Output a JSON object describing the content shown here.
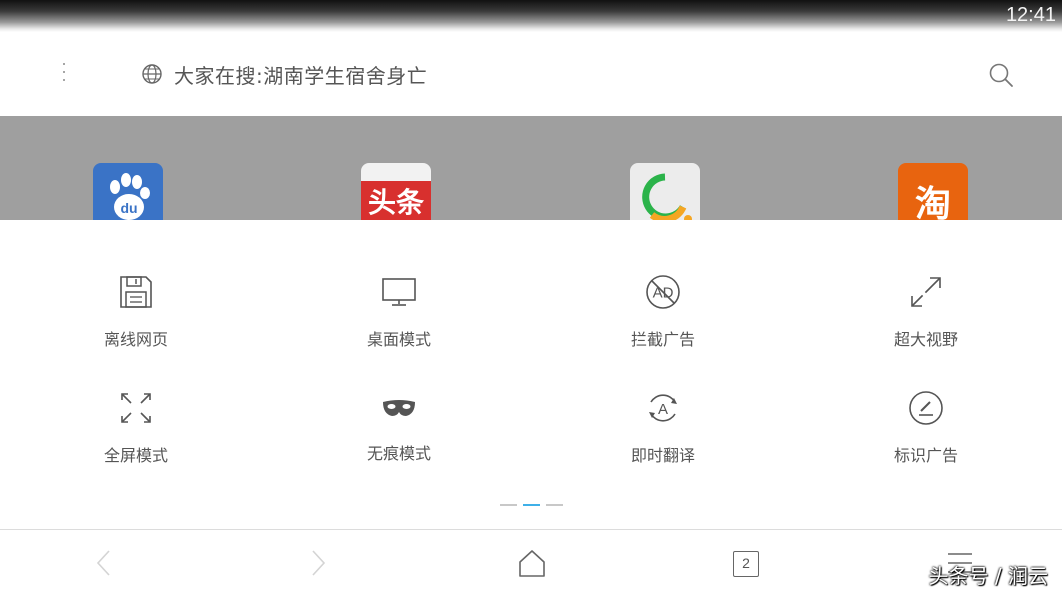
{
  "status_bar": {
    "time": "12:41"
  },
  "top_bar": {
    "search_text": "大家在搜:湖南学生宿舍身亡",
    "icons": [
      "menu-dots-icon",
      "globe-icon",
      "search-icon"
    ]
  },
  "shortcuts": [
    {
      "name": "baidu",
      "glyph": "du",
      "color": "#3a73c6"
    },
    {
      "name": "toutiao",
      "glyph": "头条",
      "color": "#d8302e"
    },
    {
      "name": "search-app",
      "glyph": "",
      "color": "#ececec"
    },
    {
      "name": "taobao",
      "glyph": "淘",
      "color": "#e8640f"
    }
  ],
  "options": [
    {
      "label": "离线网页",
      "icon": "save-icon"
    },
    {
      "label": "桌面模式",
      "icon": "monitor-icon"
    },
    {
      "label": "拦截广告",
      "icon": "ad-block-icon"
    },
    {
      "label": "超大视野",
      "icon": "expand-icon"
    },
    {
      "label": "全屏模式",
      "icon": "fullscreen-icon"
    },
    {
      "label": "无痕模式",
      "icon": "mask-icon"
    },
    {
      "label": "即时翻译",
      "icon": "translate-icon"
    },
    {
      "label": "标识广告",
      "icon": "mark-ad-icon"
    }
  ],
  "pager": {
    "count": 3,
    "active_index": 1,
    "accent": "#3fb0e8"
  },
  "bottom_bar": {
    "tab_count": "2",
    "watermark": "头条号 / 润云"
  }
}
